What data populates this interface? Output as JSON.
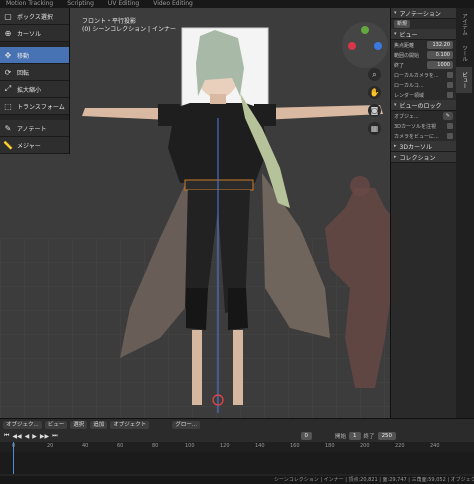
{
  "topbar": [
    "Motion Tracking",
    "Scripting",
    "UV Editing",
    "Video Editing"
  ],
  "viewport": {
    "view_name": "フロント・平行投影",
    "collection": "(0) シーンコレクション | インナー"
  },
  "tools": [
    {
      "label": "ボックス選択",
      "icon": "select-box-icon"
    },
    {
      "label": "カーソル",
      "icon": "cursor-icon"
    },
    {
      "label": "移動",
      "icon": "move-icon",
      "active": true
    },
    {
      "label": "回転",
      "icon": "rotate-icon"
    },
    {
      "label": "拡大縮小",
      "icon": "scale-icon"
    },
    {
      "label": "トランスフォーム",
      "icon": "transform-icon"
    },
    {
      "label": "アノテート",
      "icon": "annotate-icon"
    },
    {
      "label": "メジャー",
      "icon": "measure-icon"
    }
  ],
  "npanel": {
    "annotation": "アノテーション",
    "new_label": "新規",
    "view_section": "ビュー",
    "focal_label": "焦点距離",
    "focal_value": "132.20",
    "clip_start_label": "範囲の開始",
    "clip_start_value": "0.100",
    "clip_end_label": "終了",
    "clip_end_value": "1000",
    "local_camera": "ローカルカメラを...",
    "local_collection": "ローカルコ...",
    "render_region": "レンダー領域",
    "view_lock": "ビューのロック",
    "object_label": "オブジェ...",
    "lock_3d_cursor": "3Dカーソルを注視",
    "camera_to_view": "カメラをビューに...",
    "cursor_section": "3Dカーソル",
    "collection_section": "コレクション"
  },
  "ntabs": [
    "アイテム",
    "ツール",
    "ビュー"
  ],
  "header": {
    "object_mode": "オブジェク...",
    "view": "ビュー",
    "select": "選択",
    "add": "追加",
    "object": "オブジェクト",
    "global": "グロー..."
  },
  "timeline": {
    "current_frame": "0",
    "start_label": "開始",
    "start_value": "1",
    "end_label": "終了",
    "end_value": "250",
    "ruler": [
      "0",
      "20",
      "40",
      "60",
      "80",
      "100",
      "120",
      "140",
      "160",
      "180",
      "200",
      "220",
      "240"
    ]
  },
  "status": "シーンコレクション | インナー | 頂点:20,821 | 面:29,747 | 三角面:59,052 | オブジェクト..."
}
